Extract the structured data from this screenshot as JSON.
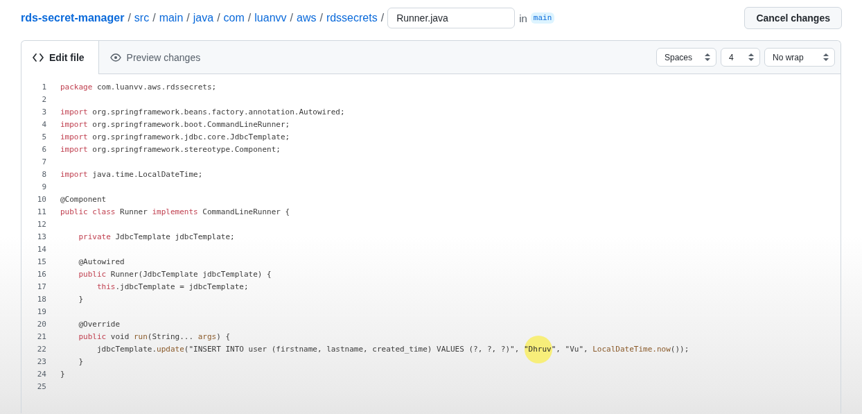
{
  "breadcrumb": {
    "repo": "rds-secret-manager",
    "folders": [
      "src",
      "main",
      "java",
      "com",
      "luanvv",
      "aws",
      "rdssecrets"
    ],
    "separator": "/"
  },
  "filename": {
    "value": "Runner.java"
  },
  "branch": {
    "prefix": "in",
    "name": "main"
  },
  "cancel_button": "Cancel changes",
  "tabs": [
    {
      "label": "Edit file",
      "selected": true
    },
    {
      "label": "Preview changes",
      "selected": false
    }
  ],
  "selects": [
    {
      "value": "Spaces"
    },
    {
      "value": "4"
    },
    {
      "value": "No wrap"
    }
  ],
  "lines": [
    {
      "number": "1",
      "tokens": [
        {
          "kind": "keyword",
          "text": "package"
        },
        {
          "kind": "plain",
          "text": " com.luanvv.aws.rdssecrets;"
        }
      ]
    },
    {
      "number": "2"
    },
    {
      "number": "3",
      "tokens": [
        {
          "kind": "keyword",
          "text": "import"
        },
        {
          "kind": "plain",
          "text": " org.springframework.beans.factory.annotation.Autowired;"
        }
      ]
    },
    {
      "number": "4",
      "tokens": [
        {
          "kind": "keyword",
          "text": "import"
        },
        {
          "kind": "plain",
          "text": " org.springframework.boot.CommandLineRunner;"
        }
      ]
    },
    {
      "number": "5",
      "tokens": [
        {
          "kind": "keyword",
          "text": "import"
        },
        {
          "kind": "plain",
          "text": " org.springframework.jdbc.core.JdbcTemplate;"
        }
      ]
    },
    {
      "number": "6",
      "tokens": [
        {
          "kind": "keyword",
          "text": "import"
        },
        {
          "kind": "plain",
          "text": " org.springframework.stereotype.Component;"
        }
      ]
    },
    {
      "number": "7"
    },
    {
      "number": "8",
      "tokens": [
        {
          "kind": "keyword",
          "text": "import"
        },
        {
          "kind": "plain",
          "text": " java.time.LocalDateTime;"
        }
      ]
    },
    {
      "number": "9"
    },
    {
      "number": "10",
      "tokens": [
        {
          "kind": "plain",
          "text": "@Component"
        }
      ]
    },
    {
      "number": "11",
      "tokens": [
        {
          "kind": "keyword",
          "text": "public class"
        },
        {
          "kind": "plain",
          "text": " Runner "
        },
        {
          "kind": "keyword",
          "text": "implements"
        },
        {
          "kind": "plain",
          "text": " CommandLineRunner {"
        }
      ]
    },
    {
      "number": "12"
    },
    {
      "number": "13",
      "tokens": [
        {
          "kind": "keyword",
          "text": "    private"
        },
        {
          "kind": "plain",
          "text": " JdbcTemplate jdbcTemplate;"
        }
      ]
    },
    {
      "number": "14"
    },
    {
      "number": "15",
      "tokens": [
        {
          "kind": "plain",
          "text": "    @Autowired"
        }
      ]
    },
    {
      "number": "16",
      "tokens": [
        {
          "kind": "keyword",
          "text": "    public"
        },
        {
          "kind": "plain",
          "text": " Runner(JdbcTemplate jdbcTemplate) {"
        }
      ]
    },
    {
      "number": "17",
      "tokens": [
        {
          "kind": "keyword",
          "text": "        this"
        },
        {
          "kind": "plain",
          "text": ".jdbcTemplate = jdbcTemplate;"
        }
      ]
    },
    {
      "number": "18",
      "tokens": [
        {
          "kind": "plain",
          "text": "    }"
        }
      ]
    },
    {
      "number": "19"
    },
    {
      "number": "20",
      "tokens": [
        {
          "kind": "plain",
          "text": "    @Override"
        }
      ]
    },
    {
      "number": "21",
      "tokens": [
        {
          "kind": "keyword",
          "text": "    public"
        },
        {
          "kind": "plain",
          "text": " void "
        },
        {
          "kind": "method",
          "text": "run"
        },
        {
          "kind": "plain",
          "text": "(String... "
        },
        {
          "kind": "method",
          "text": "args"
        },
        {
          "kind": "plain",
          "text": ") {"
        }
      ]
    },
    {
      "number": "22",
      "tokens": [
        {
          "kind": "plain",
          "text": "        jdbcTemplate."
        },
        {
          "kind": "method",
          "text": "update"
        },
        {
          "kind": "plain",
          "text": "(\"INSERT INTO user (firstname, lastname, created_time) VALUES (?, ?, ?)\", "
        },
        {
          "kind": "string",
          "text": "\"Dhruv\""
        },
        {
          "kind": "plain",
          "text": ", \"Vu\", "
        },
        {
          "kind": "method",
          "text": "LocalDateTime.now"
        },
        {
          "kind": "plain",
          "text": "());"
        }
      ]
    },
    {
      "number": "23",
      "tokens": [
        {
          "kind": "plain",
          "text": "    }"
        }
      ]
    },
    {
      "number": "24",
      "tokens": [
        {
          "kind": "plain",
          "text": "}"
        }
      ]
    },
    {
      "number": "25"
    }
  ]
}
